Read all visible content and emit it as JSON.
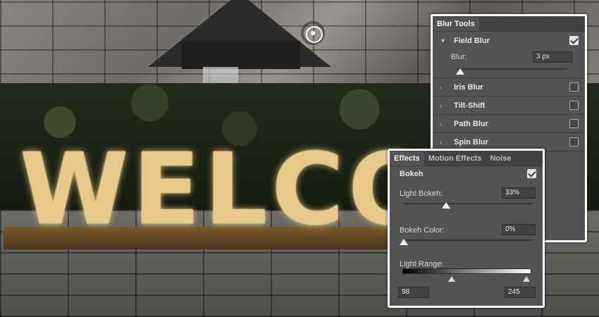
{
  "blur_tools": {
    "tab": "Blur Tools",
    "field_blur": {
      "label": "Field Blur",
      "checked": true,
      "blur_label": "Blur:",
      "blur_value": "3 px",
      "slider_fraction": 0.03
    },
    "sections": [
      {
        "label": "Iris Blur",
        "checked": false
      },
      {
        "label": "Tilt-Shift",
        "checked": false
      },
      {
        "label": "Path Blur",
        "checked": false
      },
      {
        "label": "Spin Blur",
        "checked": false
      }
    ]
  },
  "effects_panel": {
    "tabs": [
      "Effects",
      "Motion Effects",
      "Noise"
    ],
    "bokeh_label": "Bokeh",
    "bokeh_checked": true,
    "light_bokeh_label": "Light Bokeh:",
    "light_bokeh_value": "33%",
    "light_bokeh_fraction": 0.33,
    "bokeh_color_label": "Bokeh Color:",
    "bokeh_color_value": "0%",
    "bokeh_color_fraction": 0.0,
    "light_range_label": "Light Range:",
    "light_range_low": "98",
    "light_range_high": "245",
    "light_range_low_fraction": 0.38,
    "light_range_high_fraction": 0.96
  },
  "canvas": {
    "sign_text": "WELCO"
  }
}
